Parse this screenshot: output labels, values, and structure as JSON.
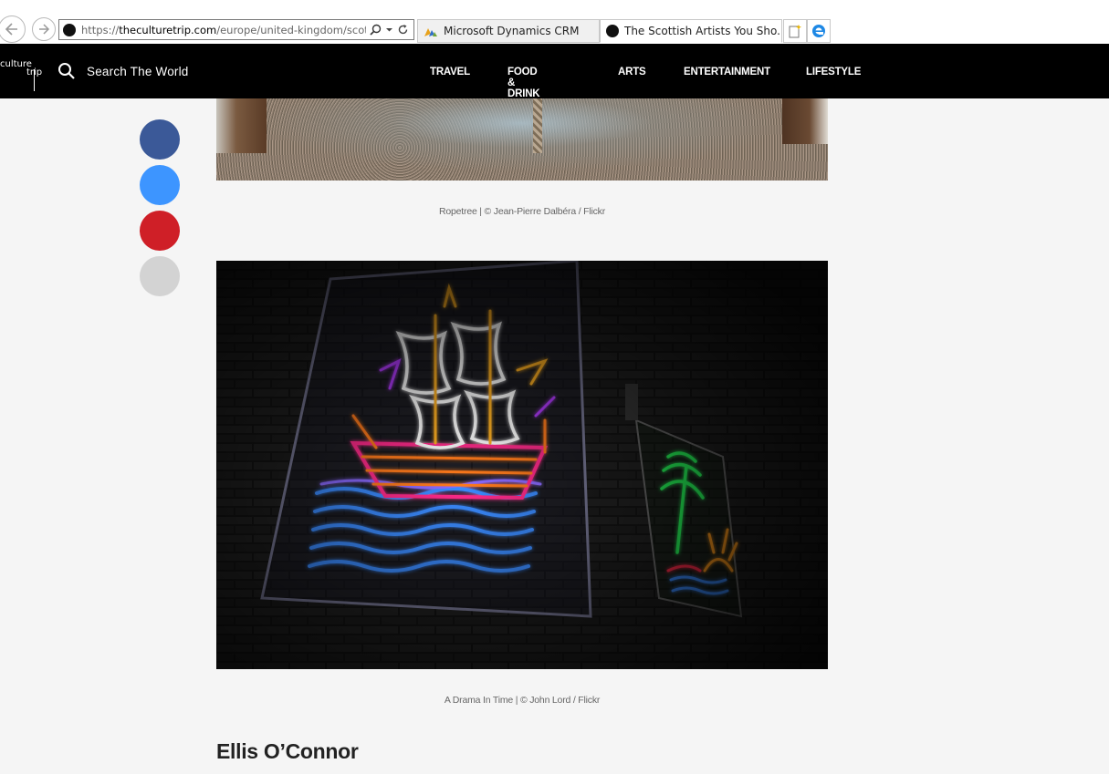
{
  "browser": {
    "url_prefix": "https://",
    "url_domain": "theculturetrip.com",
    "url_path": "/europe/united-kingdom/scotla",
    "tabs": [
      {
        "title": "Microsoft Dynamics CRM"
      },
      {
        "title": "The Scottish Artists You Sho...",
        "active": true
      }
    ]
  },
  "header": {
    "logo_line1": "culture",
    "logo_line2": "trip",
    "search_label": "Search The World",
    "nav": {
      "travel": "TRAVEL",
      "food_drink": "FOOD & DRINK",
      "arts": "ARTS",
      "entertainment": "ENTERTAINMENT",
      "lifestyle": "LIFESTYLE"
    }
  },
  "social": {
    "colors": [
      "#3b5998",
      "#3d95ff",
      "#cf1f27",
      "#d3d3d3"
    ],
    "icons": [
      "facebook-icon",
      "twitter-icon",
      "pinterest-icon",
      "more-share-icon"
    ]
  },
  "article": {
    "image1_caption": "Ropetree | © Jean-Pierre Dalbéra / Flickr",
    "image2_caption": "A Drama In Time | © John Lord / Flickr",
    "section_heading": "Ellis O’Connor"
  }
}
